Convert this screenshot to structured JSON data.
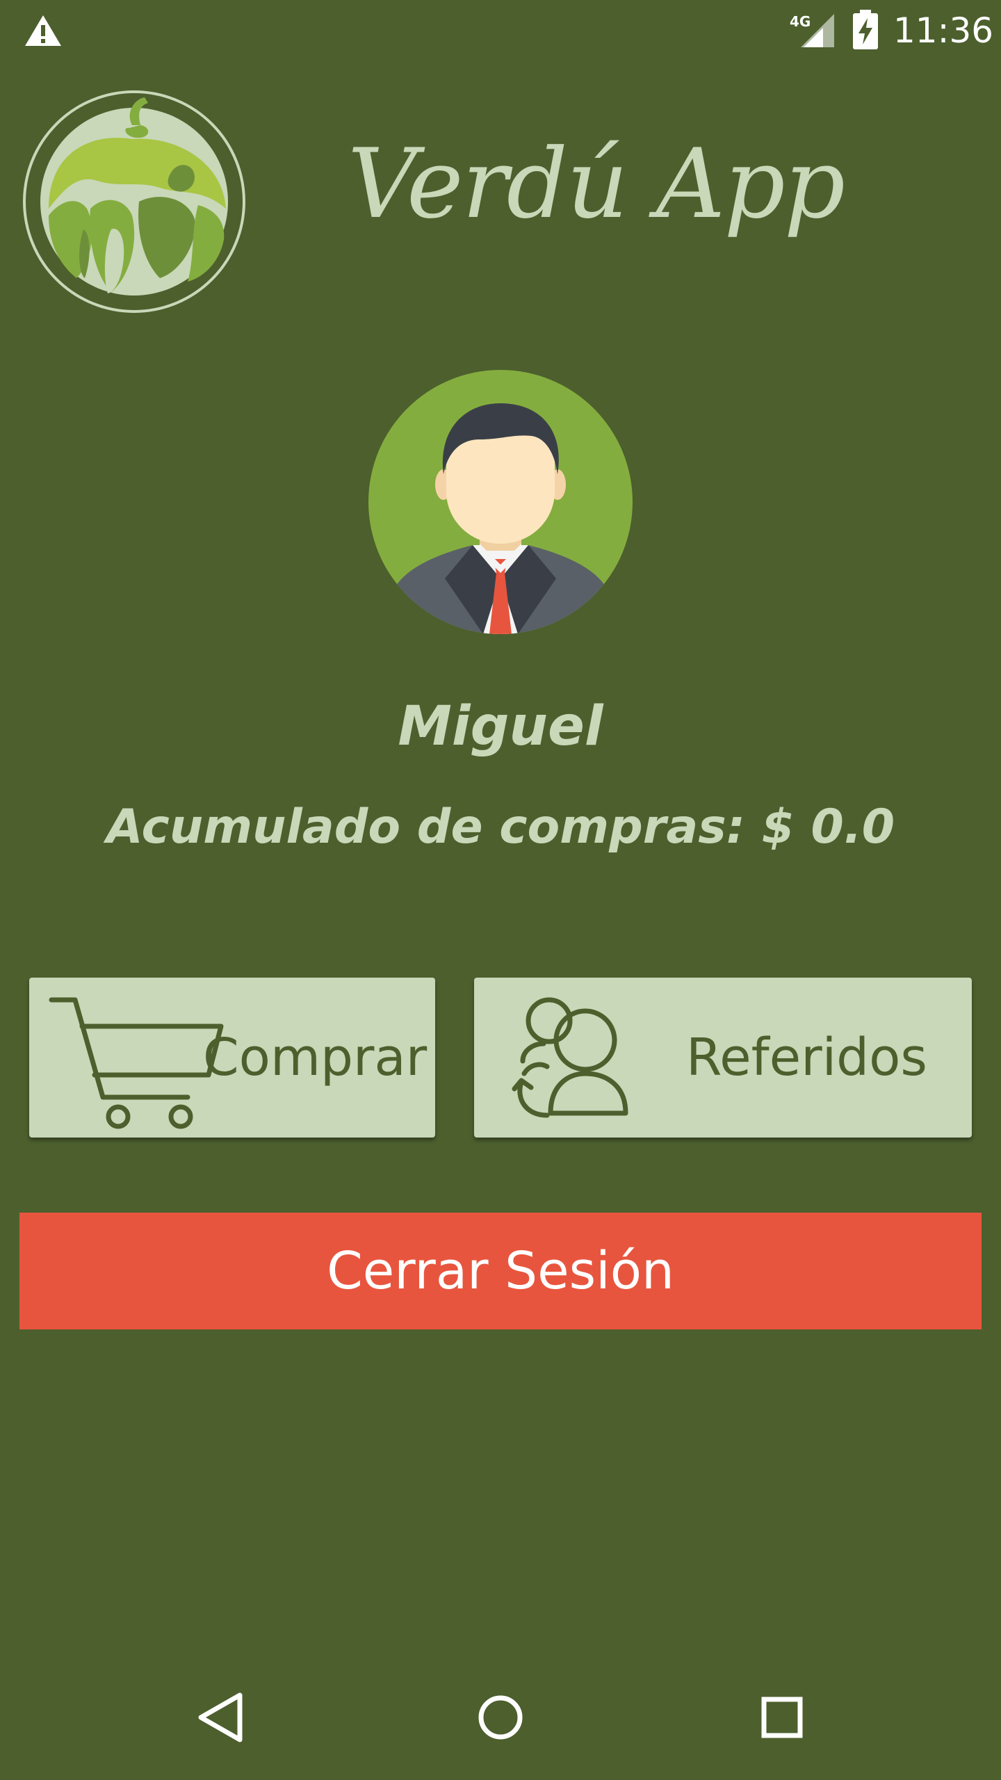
{
  "status_bar": {
    "network_label": "4G",
    "time": "11:36",
    "icons": [
      "warning-icon",
      "signal-icon",
      "battery-charging-icon"
    ]
  },
  "header": {
    "app_title": "Verdú App",
    "logo_icon": "vegetables-logo-icon"
  },
  "profile": {
    "avatar_icon": "user-avatar-icon",
    "name": "Miguel",
    "purchases_label": "Acumulado de compras: $ 0.0"
  },
  "actions": {
    "buy_label": "Comprar",
    "buy_icon": "shopping-cart-icon",
    "referrals_label": "Referidos",
    "referrals_icon": "users-refresh-icon",
    "logout_label": "Cerrar Sesión"
  },
  "navigation": {
    "icons": [
      "back-icon",
      "home-icon",
      "recent-apps-icon"
    ]
  },
  "colors": {
    "background": "#4c5f2d",
    "light_text": "#c8d8b8",
    "button_bg": "#c8d8b8",
    "logout_bg": "#e8553e",
    "avatar_bg": "#84ad3f"
  }
}
